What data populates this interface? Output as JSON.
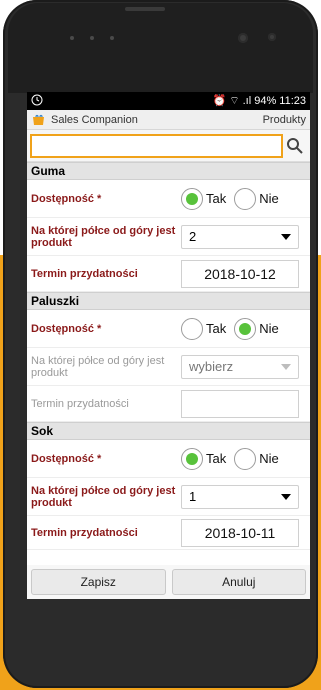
{
  "statusbar": {
    "left_icon": "alarm-icon",
    "right_text": "94% 11:23"
  },
  "app": {
    "title": "Sales Companion",
    "products_label": "Produkty",
    "logo_icon": "shopping-bag-icon"
  },
  "search": {
    "placeholder": "",
    "value": "",
    "icon": "search-icon"
  },
  "sections": [
    {
      "name": "Guma",
      "availability_label": "Dostępność *",
      "yes_label": "Tak",
      "no_label": "Nie",
      "selected": "Tak",
      "shelf_label": "Na której półce od góry jest produkt",
      "shelf_value": "2",
      "expiry_label": "Termin przydatności",
      "expiry_value": "2018-10-12"
    },
    {
      "name": "Paluszki",
      "availability_label": "Dostępność *",
      "yes_label": "Tak",
      "no_label": "Nie",
      "selected": "Nie",
      "shelf_label": "Na której półce od góry jest produkt",
      "shelf_value": "wybierz",
      "expiry_label": "Termin przydatności",
      "expiry_value": ""
    },
    {
      "name": "Sok",
      "availability_label": "Dostępność *",
      "yes_label": "Tak",
      "no_label": "Nie",
      "selected": "Tak",
      "shelf_label": "Na której półce od góry jest produkt",
      "shelf_value": "1",
      "expiry_label": "Termin przydatności",
      "expiry_value": "2018-10-11"
    }
  ],
  "actions": {
    "save": "Zapisz",
    "cancel": "Anuluj"
  },
  "colors": {
    "accent": "#f0a21a",
    "required_text": "#8b1a1a",
    "radio_on": "#58c23b"
  }
}
